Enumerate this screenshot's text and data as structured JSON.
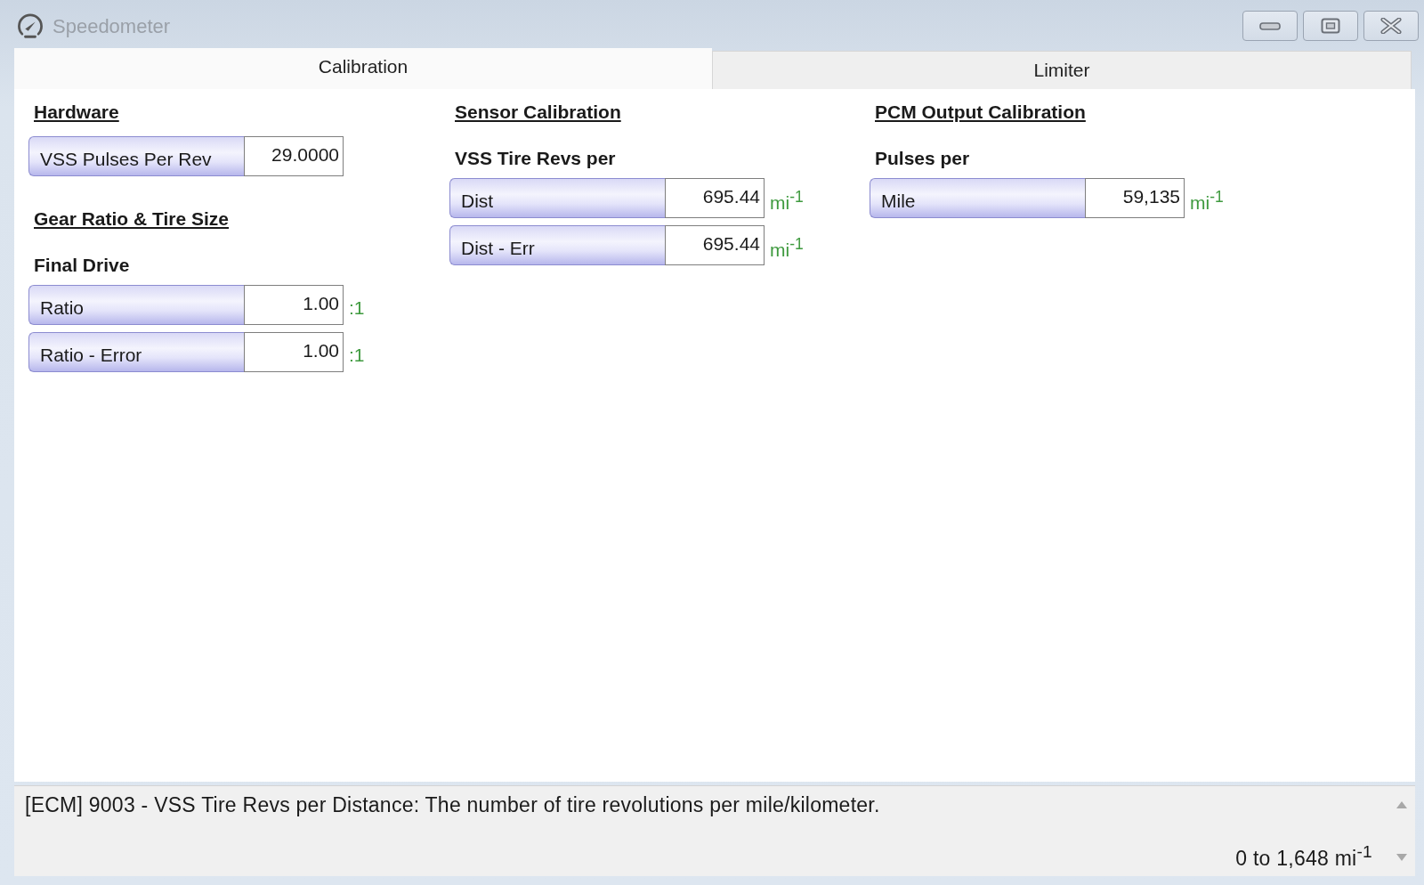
{
  "window": {
    "title": "Speedometer"
  },
  "tabs": [
    {
      "label": "Calibration",
      "selected": true
    },
    {
      "label": "Limiter",
      "selected": false
    }
  ],
  "columns": [
    {
      "items": [
        {
          "kind": "heading",
          "text": "Hardware"
        },
        {
          "kind": "field",
          "label": "VSS Pulses Per Rev",
          "value": "29.0000"
        },
        {
          "kind": "heading",
          "text": "Gear Ratio & Tire Size"
        },
        {
          "kind": "subheading",
          "text": "Final Drive"
        },
        {
          "kind": "field",
          "label": "Ratio",
          "value": "1.00",
          "unit": ":1"
        },
        {
          "kind": "field",
          "label": "Ratio - Error",
          "value": "1.00",
          "unit": ":1"
        }
      ]
    },
    {
      "items": [
        {
          "kind": "heading",
          "text": "Sensor Calibration"
        },
        {
          "kind": "subheading",
          "text": "VSS Tire Revs per"
        },
        {
          "kind": "field",
          "label": "Dist",
          "value": "695.44",
          "unit": "mi$^{-1}$"
        },
        {
          "kind": "field",
          "label": "Dist - Err",
          "value": "695.44",
          "unit": "mi$^{-1}$"
        }
      ]
    },
    {
      "items": [
        {
          "kind": "heading",
          "text": "PCM Output Calibration"
        },
        {
          "kind": "subheading",
          "text": "Pulses per"
        },
        {
          "kind": "field",
          "label": "Mile",
          "value": "59,135",
          "unit": "mi$^{-1}$"
        }
      ]
    }
  ],
  "description": {
    "text": "[ECM] 9003 - VSS Tire Revs per Distance: The number of tire revolutions per mile/kilometer.",
    "range": "0 to 1,648 mi$^{-1}$"
  }
}
